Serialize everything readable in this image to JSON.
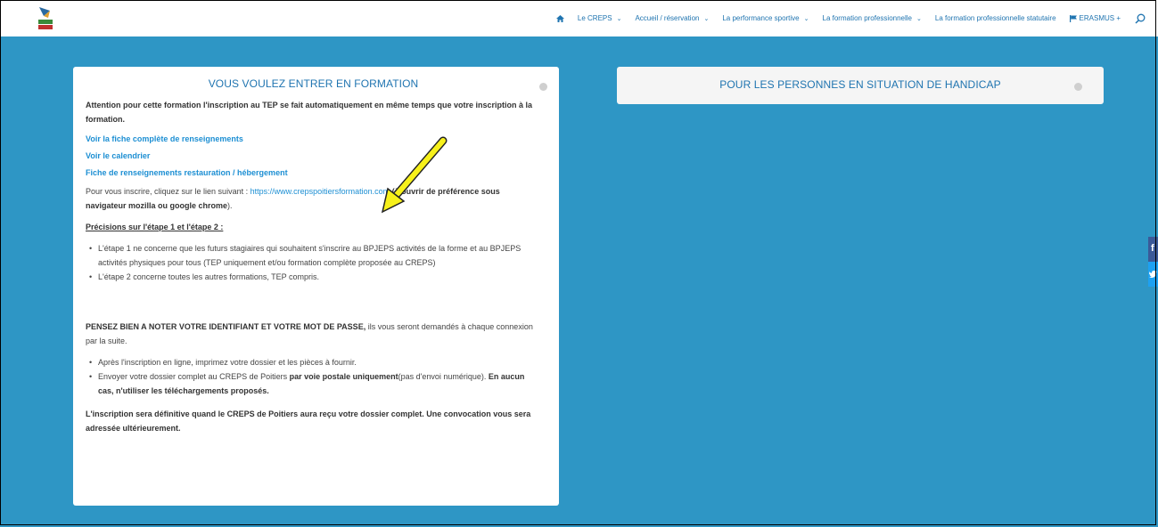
{
  "nav": {
    "items": [
      {
        "label": "Le CREPS",
        "dropdown": true
      },
      {
        "label": "Accueil / réservation",
        "dropdown": true
      },
      {
        "label": "La performance sportive",
        "dropdown": true
      },
      {
        "label": "La formation professionnelle",
        "dropdown": true
      },
      {
        "label": "La formation professionnelle statutaire",
        "dropdown": false
      }
    ],
    "erasmus_label": "ERASMUS +",
    "chevron": "⌄"
  },
  "left_card": {
    "title": "VOUS VOULEZ ENTRER EN FORMATION",
    "attention": "Attention pour cette formation l'inscription au TEP se fait automatiquement en même temps que votre inscription à la formation.",
    "link_fiche": "Voir la fiche complète de renseignements",
    "link_calendrier": "Voir le calendrier",
    "link_restauration": "Fiche de renseignements restauration / hébergement",
    "inscrire_prefix": "Pour vous inscrire, cliquez sur le lien suivant : ",
    "inscrire_url": "https://www.crepspoitiersformation.com",
    "inscrire_bold": " (à ouvrir de préférence sous navigateur mozilla ou google chrome",
    "inscrire_suffix": ").",
    "precisions_heading": "Précisions sur l'étape 1 et l'étape 2 :",
    "etapes": [
      "L'étape 1 ne concerne que les futurs stagiaires qui souhaitent s'inscrire au BPJEPS activités de la forme et au BPJEPS activités physiques pour tous (TEP uniquement et/ou formation complète proposée au CREPS)",
      "L'étape 2 concerne toutes les autres formations, TEP compris."
    ],
    "pensez_bold": "PENSEZ BIEN A NOTER VOTRE IDENTIFIANT ET VOTRE MOT DE PASSE,",
    "pensez_rest": " ils vous seront demandés à chaque connexion par la suite.",
    "apres": "Après l'inscription en ligne, imprimez votre dossier et les pièces à fournir.",
    "envoyer_prefix": "Envoyer votre dossier complet au CREPS de Poitiers ",
    "envoyer_bold": "par voie postale uniquement",
    "envoyer_mid": "(pas d'envoi numérique).  ",
    "envoyer_bold2": "En aucun cas, n'utiliser les téléchargements proposés.",
    "final": "L'inscription sera définitive quand le CREPS de Poitiers aura reçu votre dossier complet. Une convocation vous sera adressée ultérieurement."
  },
  "right_card": {
    "title": "POUR LES PERSONNES EN SITUATION DE HANDICAP"
  },
  "social": {
    "facebook": "f",
    "twitter": "🐦"
  },
  "colors": {
    "background": "#2e96c5",
    "link": "#1d8fd3",
    "nav_text": "#1f74b0",
    "arrow": "#f7f11b"
  }
}
